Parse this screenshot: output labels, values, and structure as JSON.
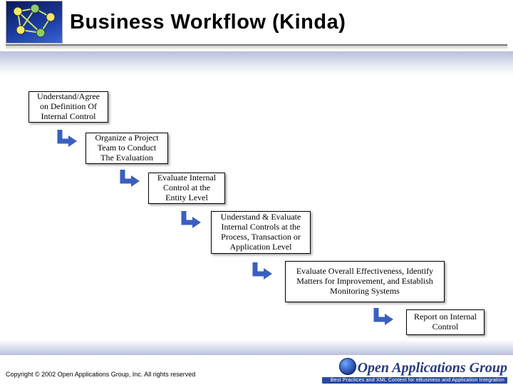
{
  "slide": {
    "title": "Business Workflow (Kinda)"
  },
  "workflow": {
    "steps": [
      "Understand/Agree on Definition Of Internal Control",
      "Organize a Project Team to Conduct The Evaluation",
      "Evaluate Internal Control at the Entity Level",
      "Understand & Evaluate Internal Controls at the Process, Transaction or Application Level",
      "Evaluate Overall Effectiveness, Identify Matters for Improvement, and Establish Monitoring Systems",
      "Report on Internal Control"
    ]
  },
  "footer": {
    "copyright": "Copyright © 2002 Open Applications Group, Inc. All rights reserved",
    "org_name": "Open Applications Group",
    "tagline": "Best Practices and XML Content for eBusiness and Application Integration"
  },
  "colors": {
    "arrow": "#3a5fbf",
    "title_rule": "#7a7a7a",
    "band": "#b8c0db",
    "logo_bg": "#1a3a9d"
  }
}
